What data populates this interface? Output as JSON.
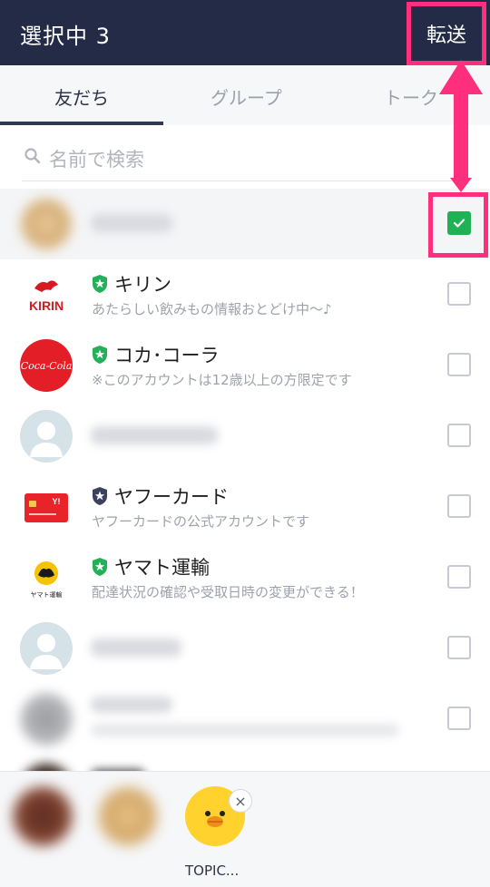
{
  "header": {
    "title": "選択中 3",
    "forward_label": "転送"
  },
  "tabs": [
    {
      "label": "友だち",
      "active": true
    },
    {
      "label": "グループ",
      "active": false
    },
    {
      "label": "トーク",
      "active": false
    }
  ],
  "search": {
    "placeholder": "名前で検索",
    "icon": "search-icon"
  },
  "contacts": [
    {
      "name": "",
      "status": "",
      "checked": true,
      "blurred": true
    },
    {
      "name": "キリン",
      "status": "あたらしい飲みもの情報おとどけ中〜♪",
      "checked": false,
      "badge": "verified-green",
      "logo": "KIRIN"
    },
    {
      "name": "コカ･コーラ",
      "status": "※このアカウントは12歳以上の方限定です",
      "checked": false,
      "badge": "verified-green",
      "logo": "Coca-Cola"
    },
    {
      "name": "",
      "status": "",
      "checked": false,
      "blurred": true
    },
    {
      "name": "ヤフーカード",
      "status": "ヤフーカードの公式アカウントです",
      "checked": false,
      "badge": "verified-navy",
      "logo": "Y!"
    },
    {
      "name": "ヤマト運輸",
      "status": "配達状況の確認や受取日時の変更ができる！",
      "checked": false,
      "badge": "verified-green",
      "logo": "ヤマト運輸"
    },
    {
      "name": "",
      "status": "",
      "checked": false,
      "blurred": true
    },
    {
      "name": "",
      "status": "",
      "checked": false,
      "blurred": true
    }
  ],
  "selected_tray": [
    {
      "label": "",
      "blurred": true
    },
    {
      "label": "",
      "blurred": true
    },
    {
      "label": "TOPIC...",
      "blurred": false,
      "remove_icon": "×"
    }
  ],
  "colors": {
    "header": "#232b47",
    "highlight": "#ff2f7d",
    "checked": "#1fb154",
    "verified_green": "#23b058",
    "verified_navy": "#3b4260"
  }
}
